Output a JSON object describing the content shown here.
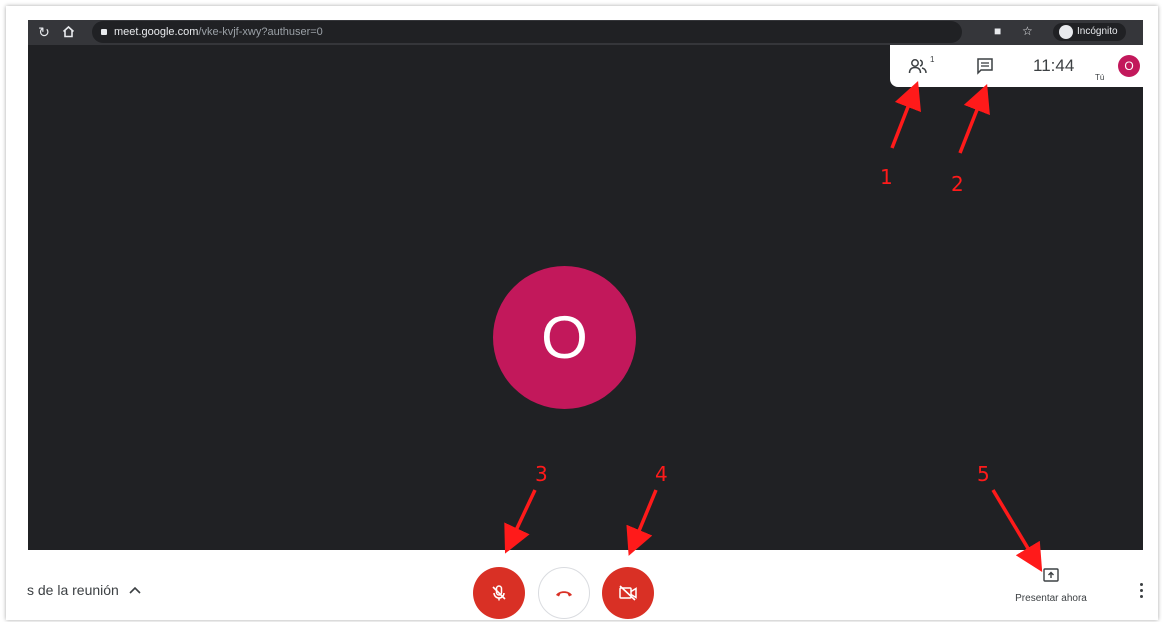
{
  "browser": {
    "url_host": "meet.google.com",
    "url_path": "/vke-kvjf-xwy?authuser=0",
    "incognito_label": "Incógnito",
    "icons": [
      "reload-icon",
      "home-icon",
      "lock-icon",
      "camera-blocked-icon",
      "star-icon",
      "incognito-icon"
    ]
  },
  "stage": {
    "avatar_initial": "O"
  },
  "info_panel": {
    "people_count": "1",
    "time": "11:44",
    "you_label": "Tú",
    "avatar_initial": "O"
  },
  "bottom_bar": {
    "meeting_details_label": "s de la reunión",
    "present_label": "Presentar ahora"
  },
  "annotations": [
    "1",
    "2",
    "3",
    "4",
    "5"
  ],
  "colors": {
    "stage_bg": "#202124",
    "avatar": "#c2185b",
    "control_red": "#d93025",
    "annotation_red": "#ff1a1a"
  }
}
